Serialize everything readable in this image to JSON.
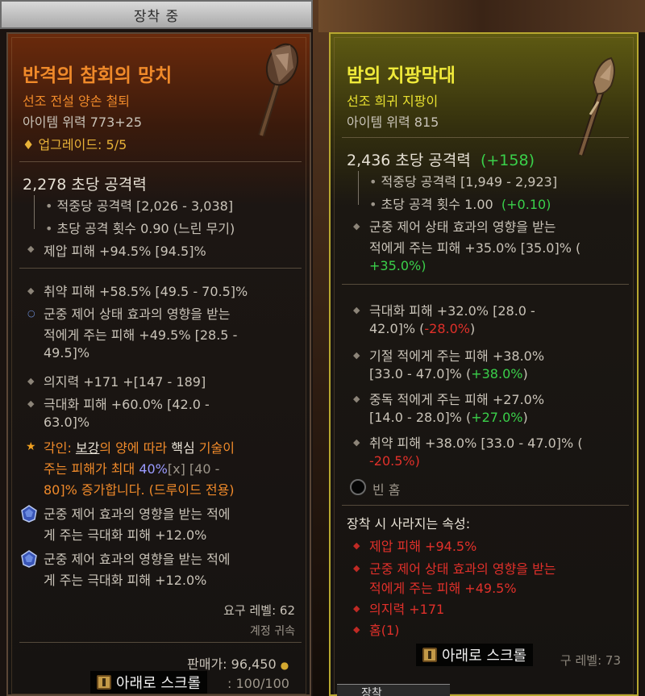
{
  "equipped_tab": "장착 중",
  "left": {
    "name": "반격의 참회의 망치",
    "type": "선조 전설 양손 철퇴",
    "item_power": "아이템 위력 773+25",
    "upgrades": "업그레이드: 5/5",
    "dps": "2,278 초당 공격력",
    "damage_per_hit": "적중당 공격력 [2,026 - 3,038]",
    "attacks_per_second": "초당 공격 횟수 0.90 (느린 무기)",
    "overpower": "제압 피해 +94.5% [94.5]%",
    "vulnerable": "취약 피해 +58.5% [49.5 - 70.5]%",
    "cc_line1": "군중 제어 상태 효과의 영향을 받는",
    "cc_line2": "적에게 주는 피해 +49.5% [28.5 -",
    "cc_line3": "49.5]%",
    "willpower": "의지력 +171 +[147 - 189]",
    "crit_line1": "극대화 피해 +60.0% [42.0 -",
    "crit_line2": "63.0]%",
    "aspect_prefix": "각인: ",
    "aspect_word1": "보강",
    "aspect_mid1": "의 양에 따라 ",
    "aspect_word2": "핵심",
    "aspect_mid2": " 기술이",
    "aspect_line2_a": "주는 피해가 최대 ",
    "aspect_value": "40%",
    "aspect_range": "[x] [40 -",
    "aspect_line3": "80]% 증가합니다. (드루이드 전용)",
    "gem1_line1": "군중 제어 효과의 영향을 받는 적에",
    "gem1_line2": "게 주는 극대화 피해 +12.0%",
    "gem2_line1": "군중 제어 효과의 영향을 받는 적에",
    "gem2_line2": "게 주는 극대화 피해 +12.0%",
    "required_level": "요구 레벨: 62",
    "account_bound": "계정 귀속",
    "sell_label": "판매가: 96,450",
    "durability": ": 100/100"
  },
  "right": {
    "name": "밤의 지팡막대",
    "type": "선조 희귀 지팡이",
    "item_power": "아이템 위력 815",
    "dps": "2,436 초당 공격력",
    "dps_diff": "(+158)",
    "damage_per_hit": "적중당 공격력 [1,949 - 2,923]",
    "attacks_per_second": "초당 공격 횟수 1.00",
    "aps_diff": "(+0.10)",
    "cc_line1": "군중 제어 상태 효과의 영향을 받는",
    "cc_line2": "적에게 주는 피해 +35.0% [35.0]% (",
    "cc_line3": "+35.0%)",
    "crit_line1": "극대화 피해 +32.0% [28.0 -",
    "crit_line2_a": "42.0]% (",
    "crit_line2_b": "-28.0%",
    "crit_line2_c": ")",
    "stun_line1": "기절 적에게 주는 피해 +38.0%",
    "stun_line2_a": "[33.0 - 47.0]% (",
    "stun_line2_b": "+38.0%",
    "stun_line2_c": ")",
    "poison_line1": "중독 적에게 주는 피해 +27.0%",
    "poison_line2_a": "[14.0 - 28.0]% (",
    "poison_line2_b": "+27.0%",
    "poison_line2_c": ")",
    "vuln_line1": "취약 피해 +38.0% [33.0 - 47.0]% (",
    "vuln_line2": "-20.5%)",
    "empty_socket": "빈 홈",
    "lost_header": "장착 시 사라지는 속성:",
    "lost1": "제압 피해 +94.5%",
    "lost2_line1": "군중 제어 상태 효과의 영향을 받는",
    "lost2_line2": "적에게 주는 피해 +49.5%",
    "lost3": "의지력 +171",
    "lost4": "홈(1)",
    "required_level": "구 레벨: 73",
    "bottom_tab": "장착"
  },
  "scroll_left": "아래로 스크롤",
  "scroll_right": "아래로 스크롤"
}
